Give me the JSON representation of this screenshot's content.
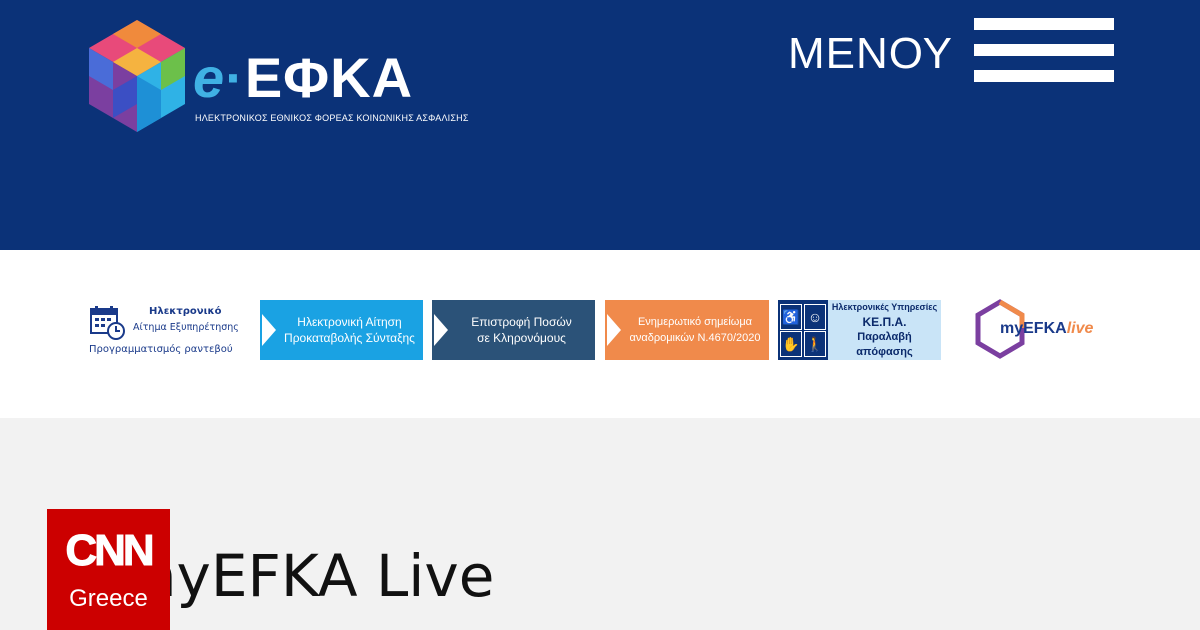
{
  "header": {
    "logo_prefix": "e",
    "logo_dot": "·",
    "logo_name": "ΕΦΚΑ",
    "logo_subtitle": "ΗΛΕΚΤΡΟΝΙΚΟΣ ΕΘΝΙΚΟΣ ΦΟΡΕΑΣ ΚΟΙΝΩΝΙΚΗΣ ΑΣΦΑΛΙΣΗΣ",
    "menu_label": "ΜΕΝΟΥ",
    "menu_icon": "hamburger-icon",
    "background": "#0b3278"
  },
  "banners": {
    "appointment": {
      "line1": "Ηλεκτρονικό",
      "line2": "Αίτημα Εξυπηρέτησης",
      "line3": "Προγραμματισμός ραντεβού",
      "icon": "calendar-clock-icon"
    },
    "items": [
      {
        "line1": "Ηλεκτρονική Αίτηση",
        "line2": "Προκαταβολής Σύνταξης",
        "color": "#1aa2e3"
      },
      {
        "line1": "Επιστροφή Ποσών",
        "line2": "σε Κληρονόμους",
        "color": "#2b5278"
      },
      {
        "line1": "Ενημερωτικό σημείωμα",
        "line2": "αναδρομικών Ν.4670/2020",
        "color": "#f08a4b"
      }
    ],
    "kepa": {
      "line1": "Ηλεκτρονικές Υπηρεσίες",
      "line2": "ΚΕ.Π.Α.",
      "line3": "Παραλαβή απόφασης",
      "icons": [
        "wheelchair-icon",
        "head-icon",
        "sign-language-icon",
        "blind-person-icon"
      ]
    },
    "myefka": {
      "prefix": "myEFKA",
      "suffix": "live"
    }
  },
  "main": {
    "title": "myEFKA Live"
  },
  "badge": {
    "mark": "CNN",
    "sub": "Greece",
    "color": "#cc0000"
  }
}
